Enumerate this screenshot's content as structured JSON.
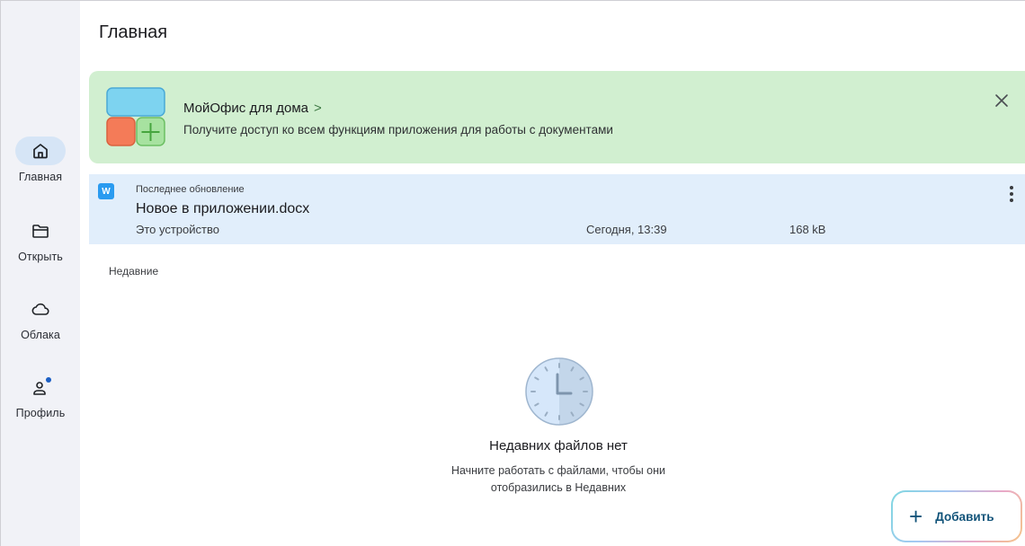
{
  "header": {
    "title": "Главная"
  },
  "sidebar": {
    "items": [
      {
        "label": "Главная",
        "icon": "home-icon",
        "active": true
      },
      {
        "label": "Открыть",
        "icon": "folder-icon",
        "active": false
      },
      {
        "label": "Облака",
        "icon": "cloud-icon",
        "active": false
      },
      {
        "label": "Профиль",
        "icon": "profile-icon",
        "active": false
      }
    ]
  },
  "promo": {
    "title": "МойОфис для дома",
    "arrow": ">",
    "subtitle": "Получите доступ ко всем функциям приложения для работы с документами",
    "close_icon": "close-icon",
    "logo": "myoffice-home-logo",
    "background": "#d1efd0"
  },
  "last_update": {
    "caption": "Последнее обновление",
    "file_icon": "W",
    "filename": "Новое в приложении.docx",
    "location": "Это устройство",
    "date": "Сегодня, 13:39",
    "size": "168 kB",
    "more_icon": "more-vertical-icon",
    "background": "#e1eefb"
  },
  "recent": {
    "label": "Недавние",
    "empty_title": "Недавних файлов нет",
    "empty_subtitle_line1": "Начните работать с файлами, чтобы они",
    "empty_subtitle_line2": "отобразились в Недавних",
    "empty_icon": "clock-icon"
  },
  "fab": {
    "plus": "+",
    "label": "Добавить"
  },
  "colors": {
    "accent": "#12547a",
    "sidebar_bg": "#f1f2f7",
    "active_nav_bg": "#d6e5f6",
    "badge": "#1b5fc4"
  }
}
